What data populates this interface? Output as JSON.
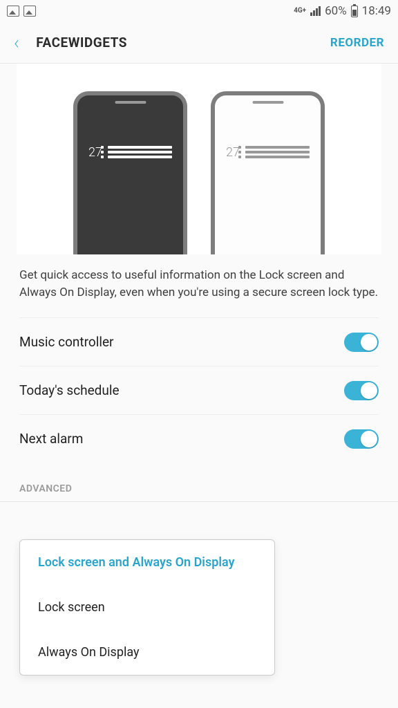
{
  "status": {
    "network": "4G+",
    "battery_pct": "60%",
    "time": "18:49"
  },
  "header": {
    "title": "FACEWIDGETS",
    "reorder": "REORDER"
  },
  "preview": {
    "widget_number": "27"
  },
  "description": "Get quick access to useful information on the Lock screen and Always On Display, even when you're using a secure screen lock type.",
  "toggles": [
    {
      "label": "Music controller",
      "on": true
    },
    {
      "label": "Today's schedule",
      "on": true
    },
    {
      "label": "Next alarm",
      "on": true
    }
  ],
  "section_advanced": "ADVANCED",
  "popup": {
    "options": [
      "Lock screen and Always On Display",
      "Lock screen",
      "Always On Display"
    ],
    "selected_index": 0
  }
}
